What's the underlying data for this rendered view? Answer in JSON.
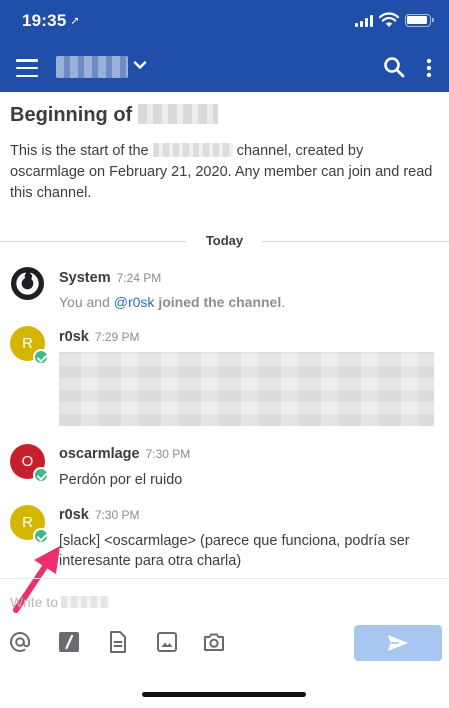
{
  "status_bar": {
    "time": "19:35",
    "location_arrow": "location-arrow-icon"
  },
  "nav": {
    "menu_icon": "hamburger-menu-icon",
    "search_icon": "search-icon",
    "more_icon": "more-vertical-icon"
  },
  "intro": {
    "title": "Beginning of",
    "text_start": "This is the start of the",
    "text_end": "channel, created by oscarmlage on February 21, 2020.  Any member can join and read this channel."
  },
  "date_separator": "Today",
  "posts": [
    {
      "author": "System",
      "time": "7:24 PM",
      "text_prefix": "You and ",
      "mention": "@r0sk",
      "text_suffix": " joined the channel",
      "text_end": "."
    },
    {
      "author": "r0sk",
      "time": "7:29 PM",
      "avatar_initial": "R"
    },
    {
      "author": "oscarmlage",
      "time": "7:30 PM",
      "avatar_initial": "O",
      "text": "Perdón por el ruido"
    },
    {
      "author": "r0sk",
      "time": "7:30 PM",
      "avatar_initial": "R",
      "text": "[slack] <oscarmlage> (parece que funciona, podría ser interesante para otra charla)"
    }
  ],
  "input": {
    "placeholder": "Write to"
  },
  "colors": {
    "header": "#1f4fa8",
    "send_button": "#a8c6ef",
    "online_badge": "#3db887",
    "avatar_yellow": "#d4b600",
    "avatar_red": "#c71f2c",
    "pointer_arrow": "#ec2e6d"
  },
  "toolbar_icons": [
    "at-mention-icon",
    "slash-command-icon",
    "file-icon",
    "image-icon",
    "camera-icon"
  ]
}
